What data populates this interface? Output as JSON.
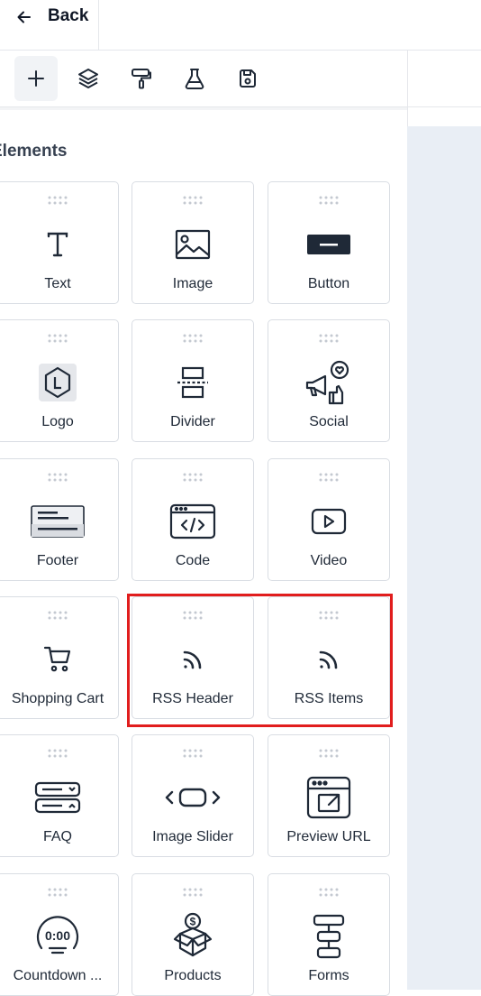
{
  "header": {
    "back_label": "Back"
  },
  "toolbar": {
    "tools": [
      {
        "icon": "plus-icon",
        "active": true
      },
      {
        "icon": "layers-icon",
        "active": false
      },
      {
        "icon": "paint-roller-icon",
        "active": false
      },
      {
        "icon": "flask-icon",
        "active": false
      },
      {
        "icon": "save-icon",
        "active": false
      }
    ]
  },
  "panel": {
    "title": "Elements",
    "elements": [
      {
        "label": "Text",
        "icon": "text-icon"
      },
      {
        "label": "Image",
        "icon": "image-icon"
      },
      {
        "label": "Button",
        "icon": "button-icon"
      },
      {
        "label": "Logo",
        "icon": "logo-icon"
      },
      {
        "label": "Divider",
        "icon": "divider-icon"
      },
      {
        "label": "Social",
        "icon": "social-icon"
      },
      {
        "label": "Footer",
        "icon": "footer-icon"
      },
      {
        "label": "Code",
        "icon": "code-icon"
      },
      {
        "label": "Video",
        "icon": "video-icon"
      },
      {
        "label": "Shopping Cart",
        "icon": "shopping-cart-icon"
      },
      {
        "label": "RSS Header",
        "icon": "rss-icon"
      },
      {
        "label": "RSS Items",
        "icon": "rss-icon"
      },
      {
        "label": "FAQ",
        "icon": "faq-icon"
      },
      {
        "label": "Image Slider",
        "icon": "image-slider-icon"
      },
      {
        "label": "Preview URL",
        "icon": "preview-url-icon"
      },
      {
        "label": "Countdown ...",
        "icon": "countdown-icon"
      },
      {
        "label": "Products",
        "icon": "products-icon"
      },
      {
        "label": "Forms",
        "icon": "forms-icon"
      }
    ]
  },
  "colors": {
    "highlight": "#e11d1d",
    "canvas": "#e9eef5",
    "icon": "#1f2937"
  }
}
